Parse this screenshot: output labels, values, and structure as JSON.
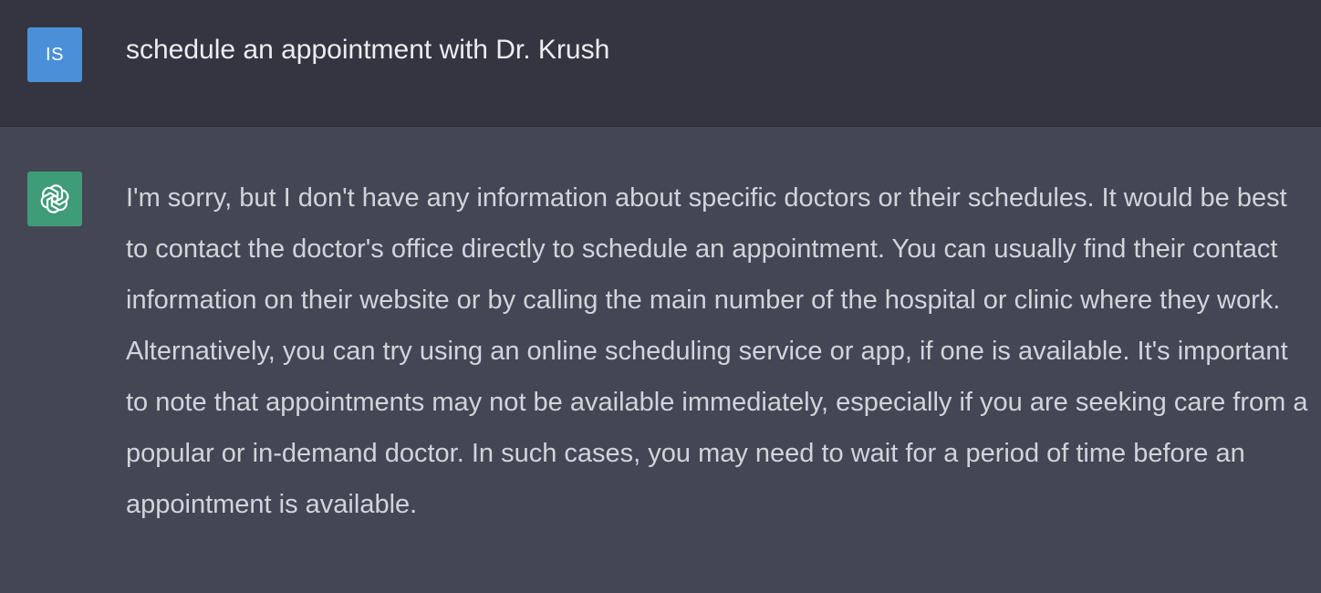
{
  "user_message": {
    "avatar_initials": "IS",
    "text": "schedule an appointment with Dr. Krush"
  },
  "assistant_message": {
    "avatar_icon": "openai-logo-icon",
    "text": "I'm sorry, but I don't have any information about specific doctors or their schedules. It would be best to contact the doctor's office directly to schedule an appointment. You can usually find their contact information on their website or by calling the main number of the hospital or clinic where they work. Alternatively, you can try using an online scheduling service or app, if one is available. It's important to note that appointments may not be available immediately, especially if you are seeking care from a popular or in-demand doctor. In such cases, you may need to wait for a period of time before an appointment is available."
  },
  "colors": {
    "user_row_bg": "#343541",
    "assistant_row_bg": "#444654",
    "user_avatar_bg": "#4a90d9",
    "assistant_avatar_bg": "#3f9c78"
  }
}
